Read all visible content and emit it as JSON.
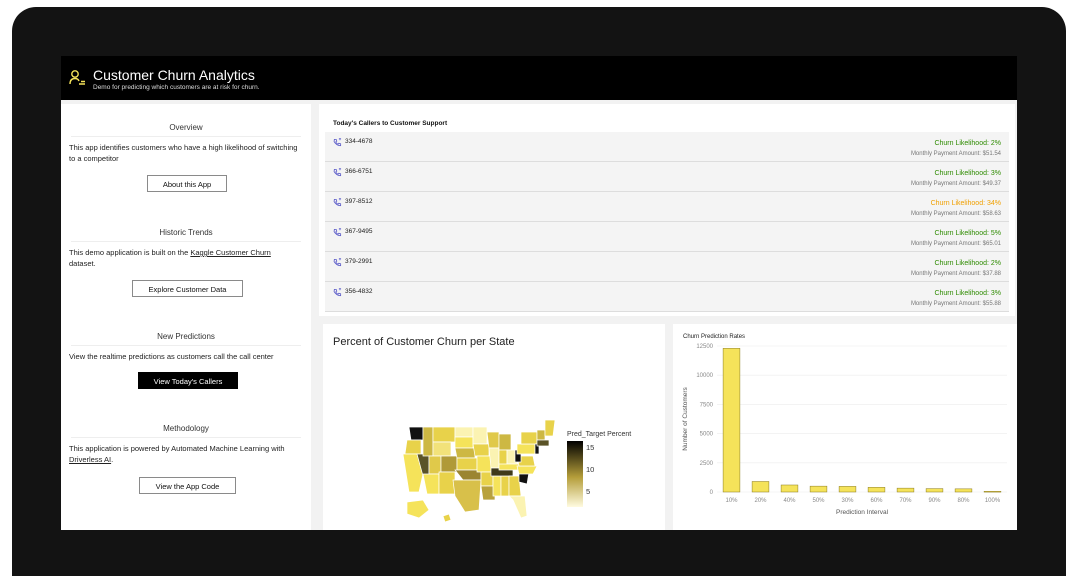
{
  "app": {
    "title": "Customer Churn Analytics",
    "subtitle": "Demo for predicting which customers are at risk for churn."
  },
  "sidebar": {
    "overview": {
      "title": "Overview",
      "text": "This app identifies customers who have a high likelihood of switching to a competitor",
      "button": "About this App"
    },
    "historic": {
      "title": "Historic Trends",
      "text_before": "This demo application is built on the ",
      "link": "Kaggle Customer Churn",
      "text_after": " dataset.",
      "button": "Explore Customer Data"
    },
    "predictions": {
      "title": "New Predictions",
      "text": "View the realtime predictions as customers call the call center",
      "button": "View Today's Callers"
    },
    "methodology": {
      "title": "Methodology",
      "text_before": "This application is powered by Automated Machine Learning with ",
      "link": "Driverless AI",
      "text_after": ".",
      "button": "View the App Code"
    }
  },
  "callers": {
    "title": "Today's Callers to Customer Support",
    "rows": [
      {
        "number": "334-4678",
        "likelihood": "Churn Likelihood: 2%",
        "payment": "Monthly Payment Amount: $51.54",
        "color": "#2e8b00"
      },
      {
        "number": "366-6751",
        "likelihood": "Churn Likelihood: 3%",
        "payment": "Monthly Payment Amount: $49.37",
        "color": "#2e8b00"
      },
      {
        "number": "397-8512",
        "likelihood": "Churn Likelihood: 34%",
        "payment": "Monthly Payment Amount: $58.63",
        "color": "#f0a000"
      },
      {
        "number": "367-9495",
        "likelihood": "Churn Likelihood: 5%",
        "payment": "Monthly Payment Amount: $65.01",
        "color": "#2e8b00"
      },
      {
        "number": "379-2991",
        "likelihood": "Churn Likelihood: 2%",
        "payment": "Monthly Payment Amount: $37.88",
        "color": "#2e8b00"
      },
      {
        "number": "356-4832",
        "likelihood": "Churn Likelihood: 3%",
        "payment": "Monthly Payment Amount: $55.88",
        "color": "#2e8b00"
      }
    ]
  },
  "map": {
    "title": "Percent of Customer Churn per State",
    "legend_title": "Pred_Target Percent",
    "legend_ticks": [
      "15",
      "10",
      "5"
    ]
  },
  "chart_data": {
    "type": "bar",
    "title": "Churn Prediction Rates",
    "xlabel": "Prediction Interval",
    "ylabel": "Number of Customers",
    "categories": [
      "10%",
      "20%",
      "40%",
      "50%",
      "30%",
      "60%",
      "70%",
      "90%",
      "80%",
      "100%"
    ],
    "values": [
      12300,
      900,
      600,
      500,
      480,
      400,
      330,
      290,
      270,
      60
    ],
    "yticks": [
      0,
      2500,
      5000,
      7500,
      10000,
      12500
    ],
    "ylim": [
      0,
      12500
    ],
    "bar_color": "#f5e35a",
    "grid": true
  },
  "colors": {
    "header_bg": "#000000",
    "accent_yellow": "#f5e35a",
    "low_risk": "#2e8b00",
    "mid_risk": "#f0a000"
  }
}
